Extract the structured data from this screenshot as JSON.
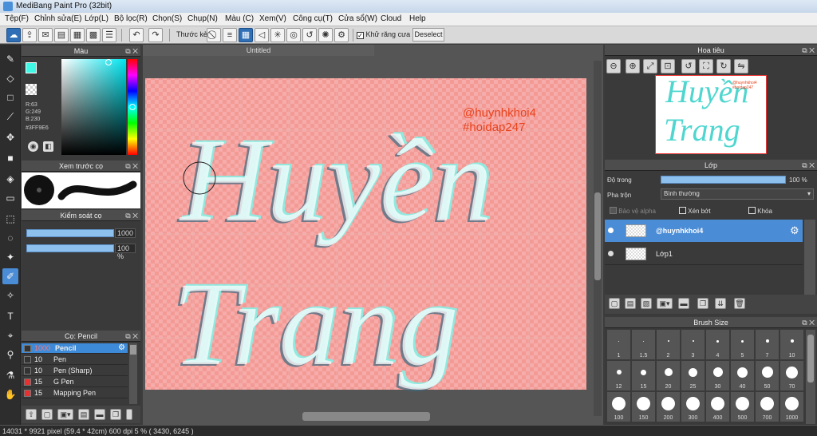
{
  "window": {
    "title": "MediBang Paint Pro (32bit)"
  },
  "menu": [
    "Tệp(F)",
    "Chỉnh sửa(E)",
    "Lớp(L)",
    "Bộ lọc(R)",
    "Chọn(S)",
    "Chụp(N)",
    "Màu (C)",
    "Xem(V)",
    "Công cụ(T)",
    "Cửa sổ(W)",
    "Cloud",
    "Help"
  ],
  "toolbar": {
    "ruler_label": "Thước kẻ",
    "antialias_label": "Khử răng cưa",
    "antialias_checked": true,
    "deselect_label": "Deselect"
  },
  "color_panel": {
    "title": "Màu",
    "fg_color": "#3FF9E6",
    "r": "R:63",
    "g": "G:249",
    "b": "B:230",
    "hex": "#3FF9E6"
  },
  "preview_panel": {
    "title": "Xem trước cọ"
  },
  "control_panel": {
    "title": "Kiểm soát cọ",
    "size_value": "1000",
    "opacity_value": "100 %"
  },
  "brush_list": {
    "title": "Cọ: Pencil",
    "items": [
      {
        "size": "1000",
        "name": "Pencil",
        "swatch": "#333333",
        "selected": true
      },
      {
        "size": "10",
        "name": "Pen",
        "swatch": "#333333",
        "selected": false
      },
      {
        "size": "10",
        "name": "Pen (Sharp)",
        "swatch": "#333333",
        "selected": false
      },
      {
        "size": "15",
        "name": "G Pen",
        "swatch": "#e83030",
        "selected": false
      },
      {
        "size": "15",
        "name": "Mapping Pen",
        "swatch": "#e83030",
        "selected": false
      }
    ]
  },
  "document": {
    "tab_title": "Untitled",
    "canvas_color": "#f49a95",
    "watermark_line1": "@huynhkhoi4",
    "watermark_line2": "#hoidap247",
    "artwork_text_line1": "Huyền",
    "artwork_text_line2": "Trang"
  },
  "navigator": {
    "title": "Hoa tiêu"
  },
  "layer_panel": {
    "title": "Lớp",
    "opacity_label": "Độ trong",
    "opacity_value": "100 %",
    "blend_label": "Pha trộn",
    "blend_value": "Bình thường",
    "protect_alpha": "Bảo vệ alpha",
    "clipping": "Xén bớt",
    "lock": "Khóa",
    "layers": [
      {
        "name": "@huynhkhoi4",
        "selected": true
      },
      {
        "name": "Lớp1",
        "selected": false
      }
    ]
  },
  "brush_size": {
    "title": "Brush Size",
    "sizes": [
      "1",
      "1.5",
      "2",
      "3",
      "4",
      "5",
      "7",
      "10",
      "12",
      "15",
      "20",
      "25",
      "30",
      "40",
      "50",
      "70",
      "100",
      "150",
      "200",
      "300",
      "400",
      "500",
      "700",
      "1000"
    ]
  },
  "statusbar": {
    "text": "14031 * 9921 pixel   (59.4 * 42cm)   600 dpi   5 %   ( 3430, 6245 )"
  }
}
